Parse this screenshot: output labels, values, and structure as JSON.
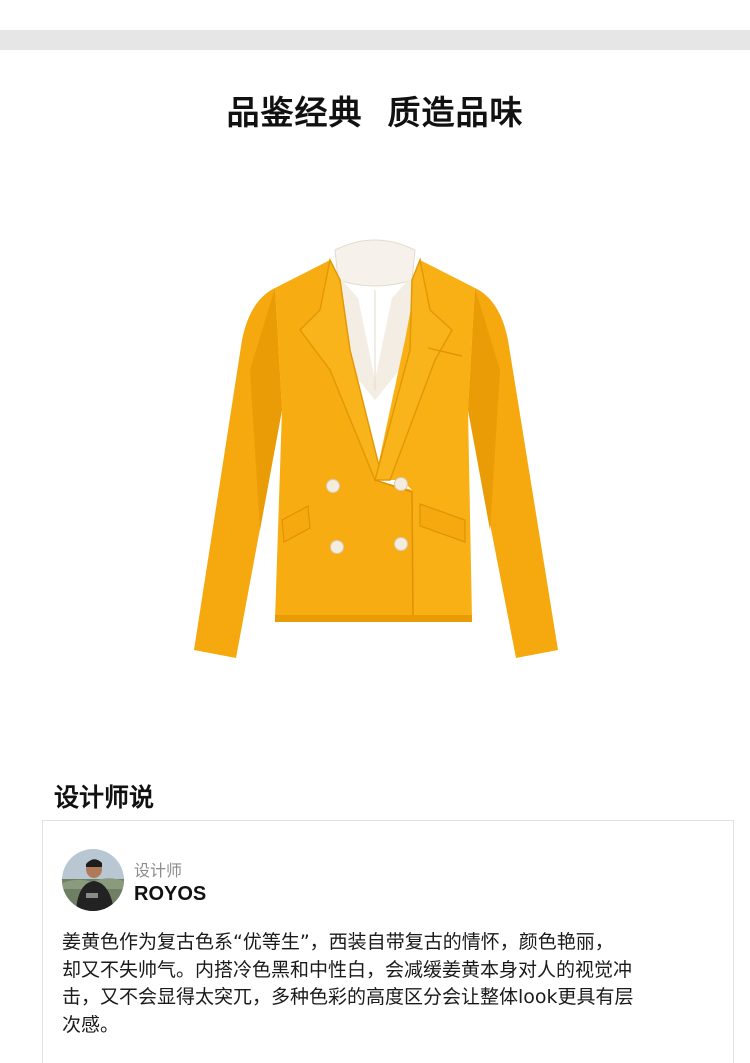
{
  "header": {
    "headline": "品鉴经典  质造品味"
  },
  "product": {
    "image_icon": "yellow-blazer-illustration",
    "colors": {
      "blazer": "#f7ad12",
      "blazer_shadow": "#e89a06",
      "shirt": "#f6f1ea",
      "button": "#f4ecdf"
    }
  },
  "designer_section": {
    "title": "设计师说",
    "role_label": "设计师",
    "name": "ROYOS",
    "avatar_icon": "designer-avatar",
    "quote_lines": [
      "姜黄色作为复古色系“优等生”，西装自带复古的情怀，颜色艳丽，",
      "却又不失帅气。内搭冷色黑和中性白，会减缓姜黄本身对人的视觉冲",
      "击，又不会显得太突兀，多种色彩的高度区分会让整体look更具有层",
      "次感。"
    ]
  }
}
